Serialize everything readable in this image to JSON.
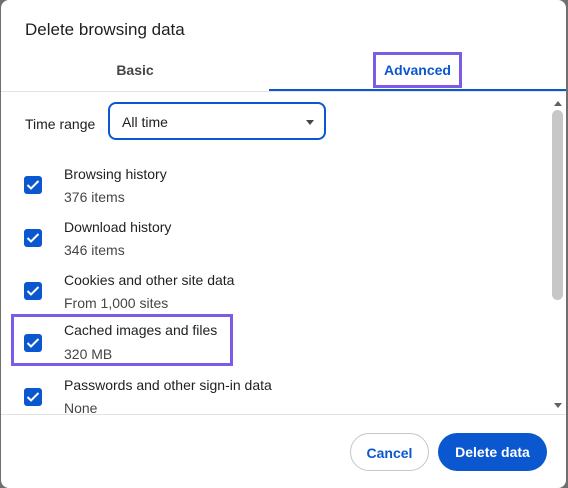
{
  "dialog": {
    "title": "Delete browsing data"
  },
  "tabs": [
    {
      "label": "Basic",
      "selected": false
    },
    {
      "label": "Advanced",
      "selected": true
    }
  ],
  "time_range": {
    "label": "Time range",
    "value": "All time"
  },
  "items": [
    {
      "label": "Browsing history",
      "detail": "376 items",
      "checked": true
    },
    {
      "label": "Download history",
      "detail": "346 items",
      "checked": true
    },
    {
      "label": "Cookies and other site data",
      "detail": "From 1,000 sites",
      "checked": true
    },
    {
      "label": "Cached images and files",
      "detail": "320 MB",
      "checked": true
    },
    {
      "label": "Passwords and other sign-in data",
      "detail": "None",
      "checked": true
    }
  ],
  "buttons": {
    "cancel": "Cancel",
    "delete": "Delete data"
  },
  "colors": {
    "accent": "#0b57d0",
    "highlight": "#7a5ce6"
  }
}
